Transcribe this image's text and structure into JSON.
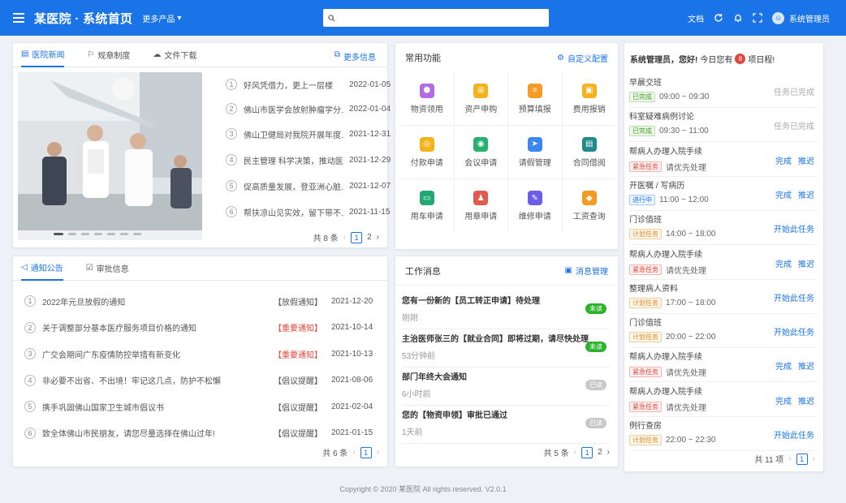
{
  "header": {
    "title": "某医院 · 系统首页",
    "more_products": "更多产品",
    "search_placeholder": "",
    "doc": "文档",
    "user": "系统管理员"
  },
  "news": {
    "tabs": [
      "医院新闻",
      "规章制度",
      "文件下载"
    ],
    "more": "更多信息",
    "items": [
      {
        "n": "1",
        "title": "好风凭借力，更上一层楼",
        "date": "2022-01-05"
      },
      {
        "n": "2",
        "title": "佛山市医学会放射肿瘤学分...",
        "date": "2022-01-04"
      },
      {
        "n": "3",
        "title": "佛山卫健局对我院开展年度...",
        "date": "2021-12-31"
      },
      {
        "n": "4",
        "title": "民主管理 科学决策，推动医...",
        "date": "2021-12-29"
      },
      {
        "n": "5",
        "title": "促高质量发展，登亚洲心脏...",
        "date": "2021-12-07"
      },
      {
        "n": "6",
        "title": "帮扶凉山见实效，留下带不...",
        "date": "2021-11-15"
      }
    ],
    "total": "共 8 条",
    "pages": [
      "1",
      "2"
    ]
  },
  "functions": {
    "title": "常用功能",
    "config": "自定义配置",
    "items": [
      {
        "label": "物资领用",
        "color": "#b36ae2",
        "glyph": "⬢"
      },
      {
        "label": "资产申购",
        "color": "#f5b21a",
        "glyph": "⊞"
      },
      {
        "label": "预算填报",
        "color": "#f59a22",
        "glyph": "≡"
      },
      {
        "label": "费用报销",
        "color": "#f5b21a",
        "glyph": "▣"
      },
      {
        "label": "付款申请",
        "color": "#f5b21a",
        "glyph": "◎"
      },
      {
        "label": "会议申请",
        "color": "#27b06e",
        "glyph": "◉"
      },
      {
        "label": "请假管理",
        "color": "#3b86f0",
        "glyph": "➤"
      },
      {
        "label": "合同借阅",
        "color": "#1f8a8a",
        "glyph": "▤"
      },
      {
        "label": "用车申请",
        "color": "#20a972",
        "glyph": "▭"
      },
      {
        "label": "用章申请",
        "color": "#e25a4b",
        "glyph": "♟"
      },
      {
        "label": "维修申请",
        "color": "#6a5ee8",
        "glyph": "✎"
      },
      {
        "label": "工资查询",
        "color": "#f59a22",
        "glyph": "◆"
      }
    ]
  },
  "tasks": {
    "greeting": "系统管理员，您好!",
    "today_prefix": "今日您有",
    "count": "8",
    "today_suffix": "项日程!",
    "items": [
      {
        "title": "早晨交班",
        "tag": "已完成",
        "tagtype": "done",
        "time": "09:00 ~ 09:30",
        "actions": [
          "任务已完成"
        ],
        "gray": true
      },
      {
        "title": "科室疑难病例讨论",
        "tag": "已完成",
        "tagtype": "done",
        "time": "09:30 ~ 11:00",
        "actions": [
          "任务已完成"
        ],
        "gray": true
      },
      {
        "title": "帮病人办理入院手续",
        "tag": "紧急任务",
        "tagtype": "urgent",
        "time": "请优先处理",
        "actions": [
          "完成",
          "推迟"
        ],
        "gray": false
      },
      {
        "title": "开医嘱 / 写病历",
        "tag": "进行中",
        "tagtype": "prog",
        "time": "11:00 ~ 12:00",
        "actions": [
          "完成",
          "推迟"
        ],
        "gray": false
      },
      {
        "title": "门诊值班",
        "tag": "计划任务",
        "tagtype": "plan",
        "time": "14:00 ~ 18:00",
        "actions": [
          "开始此任务"
        ],
        "gray": false
      },
      {
        "title": "帮病人办理入院手续",
        "tag": "紧急任务",
        "tagtype": "urgent",
        "time": "请优先处理",
        "actions": [
          "完成",
          "推迟"
        ],
        "gray": false
      },
      {
        "title": "整理病人资料",
        "tag": "计划任务",
        "tagtype": "plan",
        "time": "17:00 ~ 18:00",
        "actions": [
          "开始此任务"
        ],
        "gray": false
      },
      {
        "title": "门诊值班",
        "tag": "计划任务",
        "tagtype": "plan",
        "time": "20:00 ~ 22:00",
        "actions": [
          "开始此任务"
        ],
        "gray": false
      },
      {
        "title": "帮病人办理入院手续",
        "tag": "紧急任务",
        "tagtype": "urgent",
        "time": "请优先处理",
        "actions": [
          "完成",
          "推迟"
        ],
        "gray": false
      },
      {
        "title": "帮病人办理入院手续",
        "tag": "紧急任务",
        "tagtype": "urgent",
        "time": "请优先处理",
        "actions": [
          "完成",
          "推迟"
        ],
        "gray": false
      },
      {
        "title": "例行查房",
        "tag": "计划任务",
        "tagtype": "plan",
        "time": "22:00 ~ 22:30",
        "actions": [
          "开始此任务"
        ],
        "gray": false
      }
    ],
    "total": "共 11 项",
    "page": "1"
  },
  "notices": {
    "tabs": [
      "通知公告",
      "审批信息"
    ],
    "items": [
      {
        "n": "1",
        "title": "2022年元旦放假的通知",
        "type": "【放假通知】",
        "important": false,
        "date": "2021-12-20"
      },
      {
        "n": "2",
        "title": "关于调整部分基本医疗服务项目价格的通知",
        "type": "【重要通知】",
        "important": true,
        "date": "2021-10-14"
      },
      {
        "n": "3",
        "title": "广交会期间广东疫情防控举措有新变化",
        "type": "【重要通知】",
        "important": true,
        "date": "2021-10-13"
      },
      {
        "n": "4",
        "title": "非必要不出省、不出境！牢记这几点，防护不松懈",
        "type": "【倡议提醒】",
        "important": false,
        "date": "2021-08-06"
      },
      {
        "n": "5",
        "title": "携手巩固佛山国家卫生城市倡议书",
        "type": "【倡议提醒】",
        "important": false,
        "date": "2021-02-04"
      },
      {
        "n": "6",
        "title": "致全体佛山市民朋友，请您尽量选择在佛山过年!",
        "type": "【倡议提醒】",
        "important": false,
        "date": "2021-01-15"
      }
    ],
    "total": "共 6 条",
    "page": "1"
  },
  "messages": {
    "title": "工作消息",
    "manage": "消息管理",
    "items": [
      {
        "title": "您有一份新的【员工转正申请】待处理",
        "time": "刚刚",
        "status": "未读",
        "unread": true
      },
      {
        "title": "主治医师张三的【就业合同】即将过期，请尽快处理",
        "time": "53分钟前",
        "status": "未读",
        "unread": true
      },
      {
        "title": "部门年终大会通知",
        "time": "6小时前",
        "status": "已读",
        "unread": false
      },
      {
        "title": "您的【物资申领】审批已通过",
        "time": "1天前",
        "status": "已读",
        "unread": false
      }
    ],
    "total": "共 5 条",
    "pages": [
      "1",
      "2"
    ]
  },
  "footer": "Copyright © 2020 某医院 All rights reserved.   V2.0.1",
  "colors": {
    "accent": "#1a74e8",
    "important": "#e0463b",
    "unread": "#2ab32a",
    "read": "#c8c8c8"
  }
}
